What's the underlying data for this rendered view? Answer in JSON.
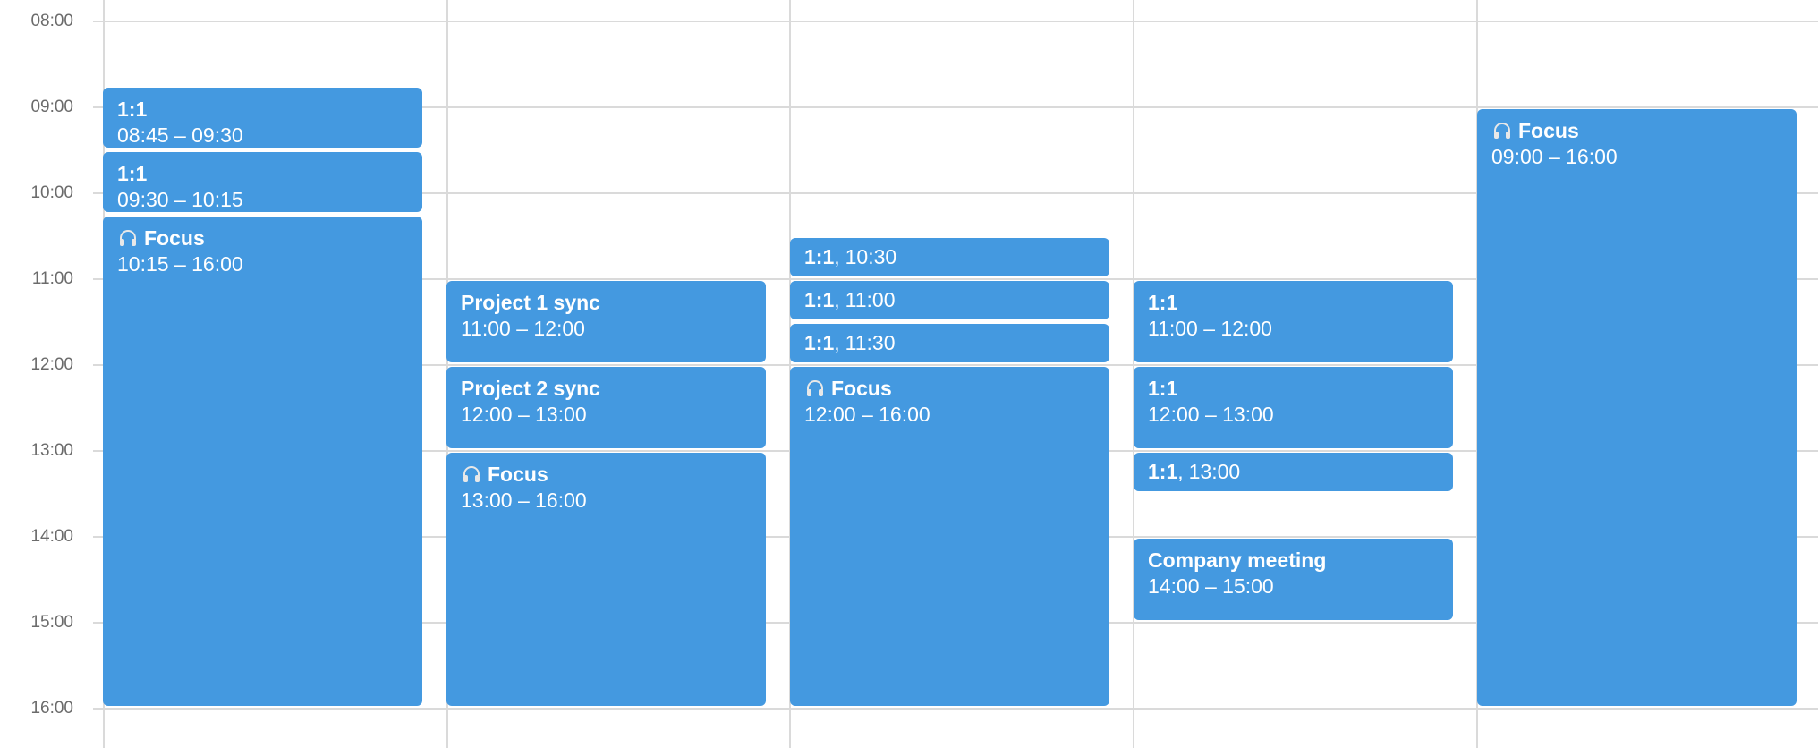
{
  "colors": {
    "event_bg": "#4499e0",
    "event_text": "#ffffff",
    "grid": "#dadada",
    "time_label": "#6b6b6b"
  },
  "time_labels": [
    "08:00",
    "09:00",
    "10:00",
    "11:00",
    "12:00",
    "13:00",
    "14:00",
    "15:00",
    "16:00"
  ],
  "days": [
    {
      "events": [
        {
          "title": "1:1",
          "time": "08:45 – 09:30",
          "icon": "",
          "compact": false
        },
        {
          "title": "1:1",
          "time": "09:30 – 10:15",
          "icon": "",
          "compact": false
        },
        {
          "title": "Focus",
          "time": "10:15 – 16:00",
          "icon": "headphones-icon",
          "compact": false
        }
      ]
    },
    {
      "events": [
        {
          "title": "Project 1 sync",
          "time": "11:00 – 12:00",
          "icon": "",
          "compact": false
        },
        {
          "title": "Project 2 sync",
          "time": "12:00 – 13:00",
          "icon": "",
          "compact": false
        },
        {
          "title": "Focus",
          "time": "13:00 – 16:00",
          "icon": "headphones-icon",
          "compact": false
        }
      ]
    },
    {
      "events": [
        {
          "title": "1:1",
          "time": "10:30",
          "icon": "",
          "compact": true
        },
        {
          "title": "1:1",
          "time": "11:00",
          "icon": "",
          "compact": true
        },
        {
          "title": "1:1",
          "time": "11:30",
          "icon": "",
          "compact": true
        },
        {
          "title": "Focus",
          "time": "12:00 – 16:00",
          "icon": "headphones-icon",
          "compact": false
        }
      ]
    },
    {
      "events": [
        {
          "title": "1:1",
          "time": "11:00 – 12:00",
          "icon": "",
          "compact": false
        },
        {
          "title": "1:1",
          "time": "12:00 – 13:00",
          "icon": "",
          "compact": false
        },
        {
          "title": "1:1",
          "time": "13:00",
          "icon": "",
          "compact": true
        },
        {
          "title": "Company meeting",
          "time": "14:00 – 15:00",
          "icon": "",
          "compact": false
        }
      ]
    },
    {
      "events": [
        {
          "title": "Focus",
          "time": "09:00 – 16:00",
          "icon": "headphones-icon",
          "compact": false
        }
      ]
    }
  ]
}
